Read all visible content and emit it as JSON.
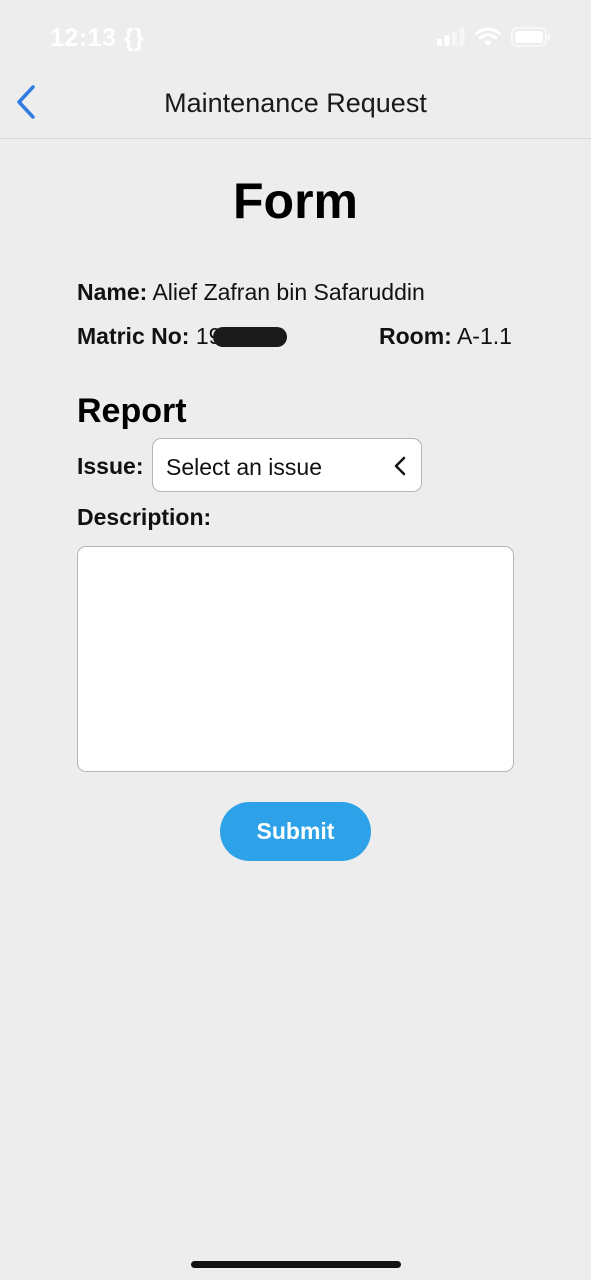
{
  "status_bar": {
    "time": "12:13 {}",
    "icons": [
      "signal-icon",
      "wifi-icon",
      "battery-icon"
    ]
  },
  "nav": {
    "back_icon": "chevron-left-icon",
    "title": "Maintenance Request"
  },
  "form": {
    "title": "Form",
    "name_label": "Name:",
    "name_value": "Alief Zafran bin Safaruddin",
    "matric_label": "Matric No:",
    "matric_value": "19",
    "room_label": "Room:",
    "room_value": "A-1.1"
  },
  "report": {
    "title": "Report",
    "issue_label": "Issue:",
    "issue_select_value": "Select an issue",
    "description_label": "Description:",
    "description_value": "",
    "submit_label": "Submit"
  },
  "colors": {
    "accent": "#2ea2e8",
    "nav_accent": "#2f7de1",
    "background": "#ededed"
  }
}
